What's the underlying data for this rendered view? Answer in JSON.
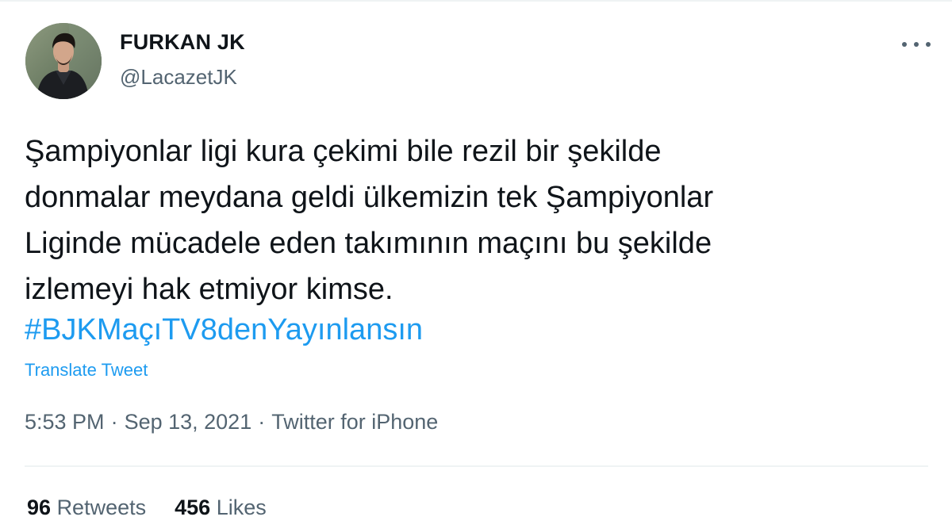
{
  "user": {
    "name": "FURKAN JK",
    "handle": "@LacazetJK",
    "avatar_icon": "profile-photo"
  },
  "tweet": {
    "lines": [
      "Şampiyonlar ligi kura çekimi bile rezil bir şekilde",
      "donmalar meydana geldi ülkemizin tek Şampiyonlar",
      "Liginde mücadele eden takımının maçını bu şekilde",
      "izlemeyi hak etmiyor kimse."
    ],
    "hashtag": "#BJKMaçıTV8denYayınlansın",
    "translate_label": "Translate Tweet",
    "time": "5:53 PM",
    "date": "Sep 13, 2021",
    "source": "Twitter for iPhone",
    "separator": "·"
  },
  "stats": {
    "retweets_count": "96",
    "retweets_label": "Retweets",
    "likes_count": "456",
    "likes_label": "Likes"
  },
  "colors": {
    "link": "#1d9bf0",
    "secondary_text": "#536471",
    "primary_text": "#0f1419",
    "divider": "#eff3f4"
  },
  "icons": {
    "more": "more-options-icon"
  }
}
